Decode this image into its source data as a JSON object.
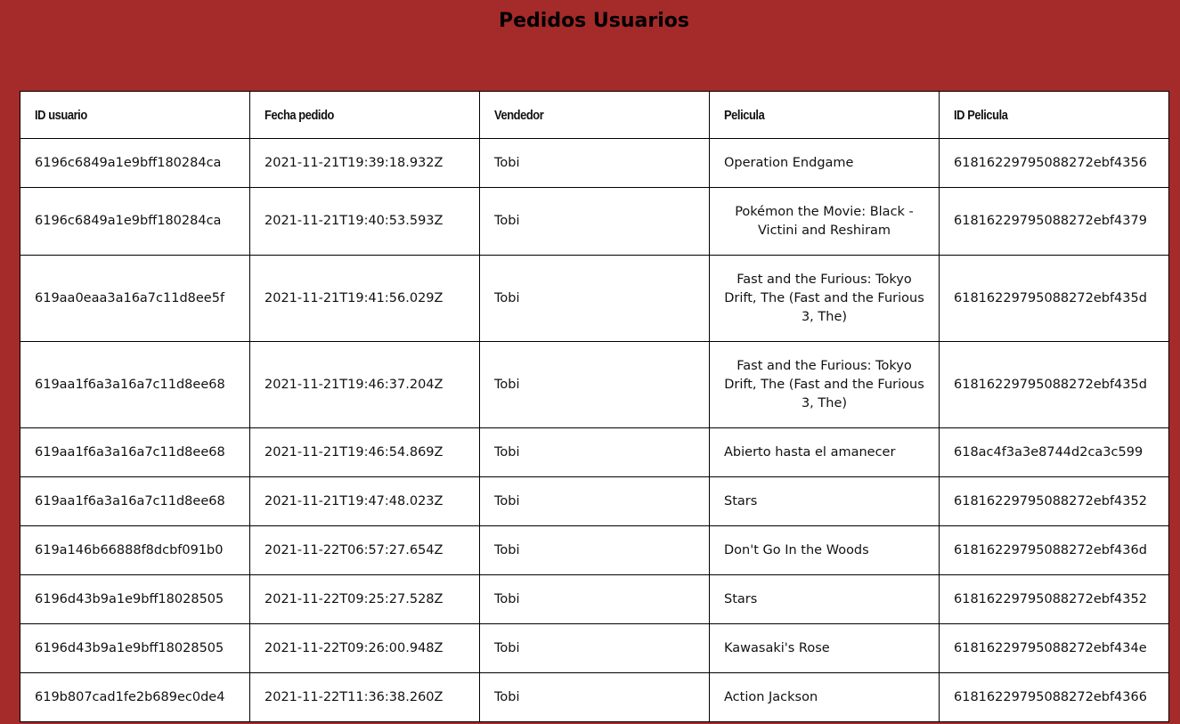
{
  "page": {
    "title": "Pedidos Usuarios",
    "background_color": "#a52a2a"
  },
  "table": {
    "headers": [
      "ID usuario",
      "Fecha pedido",
      "Vendedor",
      "Pelicula",
      "ID Pelicula"
    ],
    "rows": [
      {
        "user_id": "6196c6849a1e9bff180284ca",
        "date": "2021-11-21T19:39:18.932Z",
        "seller": "Tobi",
        "movie": "Operation Endgame",
        "movie_id": "61816229795088272ebf4356"
      },
      {
        "user_id": "6196c6849a1e9bff180284ca",
        "date": "2021-11-21T19:40:53.593Z",
        "seller": "Tobi",
        "movie": "Pokémon the Movie: Black - Victini and Reshiram",
        "movie_id": "61816229795088272ebf4379"
      },
      {
        "user_id": "619aa0eaa3a16a7c11d8ee5f",
        "date": "2021-11-21T19:41:56.029Z",
        "seller": "Tobi",
        "movie": "Fast and the Furious: Tokyo Drift, The (Fast and the Furious 3, The)",
        "movie_id": "61816229795088272ebf435d"
      },
      {
        "user_id": "619aa1f6a3a16a7c11d8ee68",
        "date": "2021-11-21T19:46:37.204Z",
        "seller": "Tobi",
        "movie": "Fast and the Furious: Tokyo Drift, The (Fast and the Furious 3, The)",
        "movie_id": "61816229795088272ebf435d"
      },
      {
        "user_id": "619aa1f6a3a16a7c11d8ee68",
        "date": "2021-11-21T19:46:54.869Z",
        "seller": "Tobi",
        "movie": "Abierto hasta el amanecer",
        "movie_id": "618ac4f3a3e8744d2ca3c599"
      },
      {
        "user_id": "619aa1f6a3a16a7c11d8ee68",
        "date": "2021-11-21T19:47:48.023Z",
        "seller": "Tobi",
        "movie": "Stars",
        "movie_id": "61816229795088272ebf4352"
      },
      {
        "user_id": "619a146b66888f8dcbf091b0",
        "date": "2021-11-22T06:57:27.654Z",
        "seller": "Tobi",
        "movie": "Don't Go In the Woods",
        "movie_id": "61816229795088272ebf436d"
      },
      {
        "user_id": "6196d43b9a1e9bff18028505",
        "date": "2021-11-22T09:25:27.528Z",
        "seller": "Tobi",
        "movie": "Stars",
        "movie_id": "61816229795088272ebf4352"
      },
      {
        "user_id": "6196d43b9a1e9bff18028505",
        "date": "2021-11-22T09:26:00.948Z",
        "seller": "Tobi",
        "movie": "Kawasaki's Rose",
        "movie_id": "61816229795088272ebf434e"
      },
      {
        "user_id": "619b807cad1fe2b689ec0de4",
        "date": "2021-11-22T11:36:38.260Z",
        "seller": "Tobi",
        "movie": "Action Jackson",
        "movie_id": "61816229795088272ebf4366"
      }
    ]
  }
}
